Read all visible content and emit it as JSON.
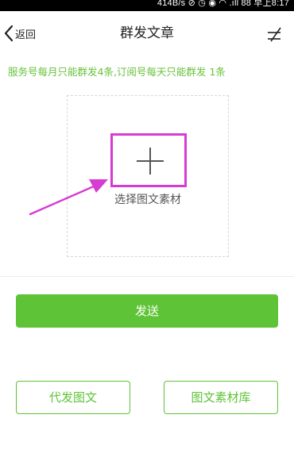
{
  "status_bar": {
    "text": "414B/s ⊘ ◷ ◉ ◠ .ıll 88 早上8:17"
  },
  "nav": {
    "back_label": "返回",
    "title": "群发文章"
  },
  "notice": "服务号每月只能群发4条,订阅号每天只能群发 1条",
  "picker": {
    "label": "选择图文素材"
  },
  "actions": {
    "send_label": "发送",
    "proxy_send_label": "代发图文",
    "library_label": "图文素材库"
  },
  "colors": {
    "accent": "#5fc337",
    "notice": "#67c23a",
    "highlight": "#d63cd2"
  }
}
